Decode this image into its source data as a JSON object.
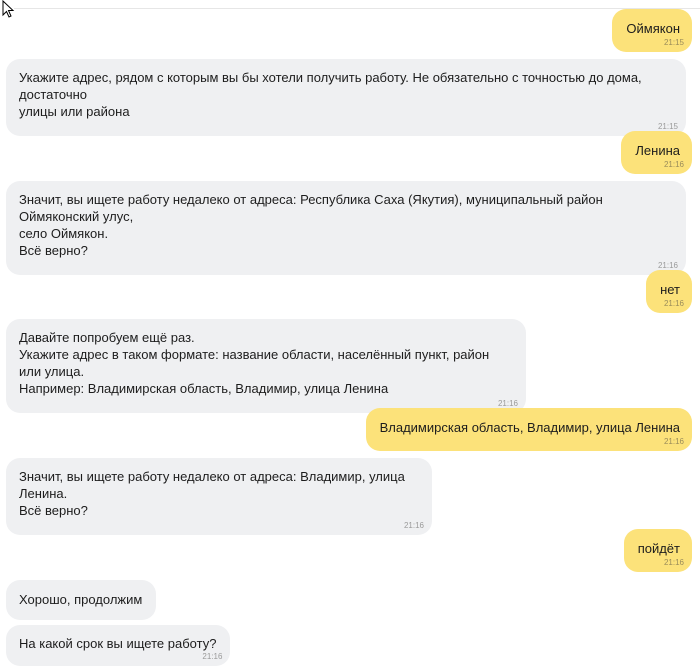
{
  "messages": [
    {
      "sender": "user",
      "text": "Оймякон",
      "time": "21:15"
    },
    {
      "sender": "bot",
      "text": "Укажите адрес, рядом с которым вы бы хотели получить работу. Не обязательно с точностью до дома, достаточно\nулицы или района",
      "time": "21:15"
    },
    {
      "sender": "user",
      "text": "Ленина",
      "time": "21:16"
    },
    {
      "sender": "bot",
      "text": "Значит, вы ищете работу недалеко от адреса: Республика Саха (Якутия), муниципальный район Оймяконский улус,\nсело Оймякон.\nВсё верно?",
      "time": "21:16"
    },
    {
      "sender": "user",
      "text": "нет",
      "time": "21:16"
    },
    {
      "sender": "bot",
      "text": "Давайте попробуем ещё раз.\nУкажите адрес в таком формате: название области, населённый пункт, район или улица.\nНапример: Владимирская область, Владимир, улица Ленина",
      "time": "21:16"
    },
    {
      "sender": "user",
      "text": "Владимирская область, Владимир, улица Ленина",
      "time": "21:16"
    },
    {
      "sender": "bot",
      "text": "Значит, вы ищете работу недалеко от адреса: Владимир, улица Ленина.\nВсё верно?",
      "time": "21:16"
    },
    {
      "sender": "user",
      "text": "пойдёт",
      "time": "21:16"
    },
    {
      "sender": "bot",
      "text": "Хорошо, продолжим",
      "time": ""
    },
    {
      "sender": "bot",
      "text": "На какой срок вы ищете работу?",
      "time": "21:16"
    }
  ]
}
